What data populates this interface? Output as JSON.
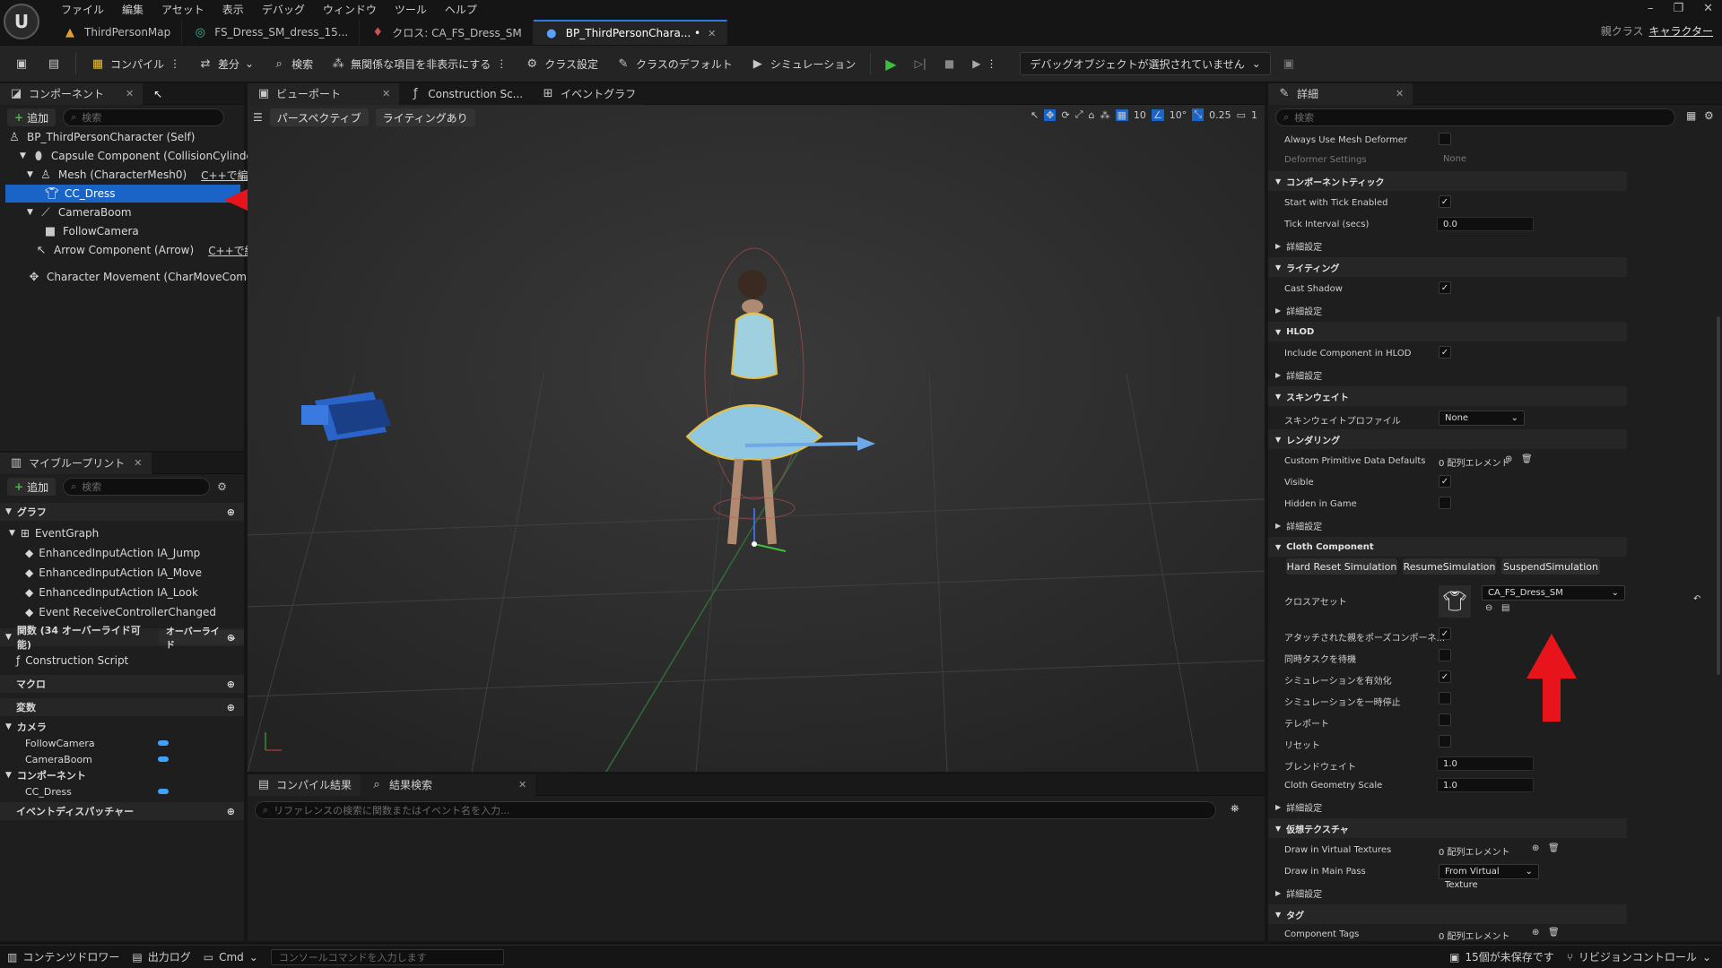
{
  "menu": [
    "ファイル",
    "編集",
    "アセット",
    "表示",
    "デバッグ",
    "ウィンドウ",
    "ツール",
    "ヘルプ"
  ],
  "tabs": [
    {
      "label": "ThirdPersonMap",
      "icon": "level-icon"
    },
    {
      "label": "FS_Dress_SM_dress_15...",
      "icon": "material-icon"
    },
    {
      "label": "クロス: CA_FS_Dress_SM",
      "icon": "cloth-icon"
    },
    {
      "label": "BP_ThirdPersonChara... •",
      "icon": "blueprint-icon"
    }
  ],
  "parent_class": {
    "label": "親クラス",
    "value": "キャラクター"
  },
  "toolbar": {
    "compile": "コンパイル",
    "diff": "差分",
    "find": "検索",
    "hide": "無関係な項目を非表示にする",
    "class_settings": "クラス設定",
    "class_defaults": "クラスのデフォルト",
    "simulation": "シミュレーション",
    "debug_object": "デバッグオブジェクトが選択されていません"
  },
  "components": {
    "tab": "コンポーネント",
    "add": "追加",
    "search_placeholder": "検索",
    "items": [
      {
        "label": "BP_ThirdPersonCharacter (Self)"
      },
      {
        "label": "Capsule Component (CollisionCylinder)"
      },
      {
        "label": "Mesh (CharacterMesh0)",
        "cpp": "C++で編集"
      },
      {
        "label": "CC_Dress"
      },
      {
        "label": "CameraBoom"
      },
      {
        "label": "FollowCamera"
      },
      {
        "label": "Arrow Component (Arrow)",
        "cpp": "C++で編集"
      },
      {
        "label": "Character Movement (CharMoveComp)"
      }
    ]
  },
  "my_blueprint": {
    "tab": "マイブループリント",
    "add": "追加",
    "search_placeholder": "検索",
    "graph": "グラフ",
    "event_graph": "EventGraph",
    "events": [
      "EnhancedInputAction IA_Jump",
      "EnhancedInputAction IA_Move",
      "EnhancedInputAction IA_Look",
      "Event ReceiveControllerChanged"
    ],
    "functions": "関数 (34 オーバーライド可能)",
    "override": "オーバーライド",
    "construction": "Construction Script",
    "macros": "マクロ",
    "variables": "変数",
    "camera_cat": "カメラ",
    "camera_vars": [
      "FollowCamera",
      "CameraBoom"
    ],
    "component_cat": "コンポーネント",
    "component_vars": [
      "CC_Dress"
    ],
    "dispatchers": "イベントディスパッチャー"
  },
  "viewport": {
    "tabs": [
      "ビューポート",
      "Construction Sc...",
      "イベントグラフ"
    ],
    "perspective": "パースペクティブ",
    "lighting": "ライティングあり",
    "grid": "10",
    "angle": "10°",
    "scale": "0.25",
    "camera": "1"
  },
  "compile_results": {
    "tabs": [
      "コンパイル結果",
      "結果検索"
    ],
    "search_placeholder": "リファレンスの検索に関数またはイベント名を入力..."
  },
  "details": {
    "tab": "詳細",
    "search_placeholder": "検索",
    "always_deformer": "Always Use Mesh Deformer",
    "deformer_settings": "Deformer Settings",
    "none": "None",
    "tick_sect": "コンポーネントティック",
    "start_tick": "Start with Tick Enabled",
    "tick_interval": "Tick Interval (secs)",
    "tick_val": "0.0",
    "advanced": "詳細設定",
    "lighting_sect": "ライティング",
    "cast_shadow": "Cast Shadow",
    "hlod_sect": "HLOD",
    "include_hlod": "Include Component in HLOD",
    "skin_sect": "スキンウェイト",
    "skin_profile": "スキンウェイトプロファイル",
    "skin_val": "None",
    "render_sect": "レンダリング",
    "cpd": "Custom Primitive Data Defaults",
    "elements0": "0 配列エレメント",
    "visible": "Visible",
    "hidden": "Hidden in Game",
    "cloth_sect": "Cloth Component",
    "hard_reset": "Hard Reset Simulation",
    "resume": "ResumeSimulation",
    "suspend": "SuspendSimulation",
    "cloth_asset": "クロスアセット",
    "cloth_asset_val": "CA_FS_Dress_SM",
    "attached": "アタッチされた親をポーズコンポーネ...",
    "wait_task": "同時タスクを待機",
    "enable_sim": "シミュレーションを有効化",
    "pause_sim": "シミュレーションを一時停止",
    "teleport": "テレポート",
    "reset": "リセット",
    "blend": "ブレンドウェイト",
    "blend_val": "1.0",
    "geo_scale": "Cloth Geometry Scale",
    "geo_val": "1.0",
    "vt_sect": "仮想テクスチャ",
    "draw_vt": "Draw in Virtual Textures",
    "draw_main": "Draw in Main Pass",
    "draw_main_val": "From Virtual Texture",
    "tag_sect": "タグ",
    "comp_tags": "Component Tags"
  },
  "status": {
    "content_drawer": "コンテンツドロワー",
    "output_log": "出力ログ",
    "cmd": "Cmd",
    "console_placeholder": "コンソールコマンドを入力します",
    "unsaved": "15個が未保存です",
    "source_control": "リビジョンコントロール"
  }
}
